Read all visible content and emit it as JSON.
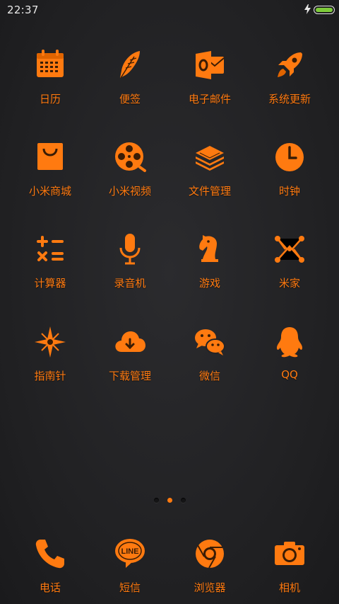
{
  "status_bar": {
    "time": "22:37",
    "battery_level_percent": 100
  },
  "accent_color": "#ff7a10",
  "apps": [
    {
      "label": "日历",
      "icon": "calendar-icon"
    },
    {
      "label": "便签",
      "icon": "feather-icon"
    },
    {
      "label": "电子邮件",
      "icon": "outlook-mail-icon"
    },
    {
      "label": "系统更新",
      "icon": "rocket-icon"
    },
    {
      "label": "小米商城",
      "icon": "shopping-bag-icon"
    },
    {
      "label": "小米视频",
      "icon": "film-reel-icon"
    },
    {
      "label": "文件管理",
      "icon": "layers-icon"
    },
    {
      "label": "时钟",
      "icon": "clock-icon"
    },
    {
      "label": "计算器",
      "icon": "calculator-icon"
    },
    {
      "label": "录音机",
      "icon": "microphone-icon"
    },
    {
      "label": "游戏",
      "icon": "chess-knight-icon"
    },
    {
      "label": "米家",
      "icon": "network-nodes-icon"
    },
    {
      "label": "指南针",
      "icon": "compass-star-icon"
    },
    {
      "label": "下载管理",
      "icon": "cloud-download-icon"
    },
    {
      "label": "微信",
      "icon": "wechat-icon"
    },
    {
      "label": "QQ",
      "icon": "qq-penguin-icon"
    }
  ],
  "pager": {
    "page_count": 3,
    "active_index": 1
  },
  "dock": [
    {
      "label": "电话",
      "icon": "phone-icon"
    },
    {
      "label": "短信",
      "icon": "line-chat-icon"
    },
    {
      "label": "浏览器",
      "icon": "chrome-icon"
    },
    {
      "label": "相机",
      "icon": "camera-icon"
    }
  ]
}
